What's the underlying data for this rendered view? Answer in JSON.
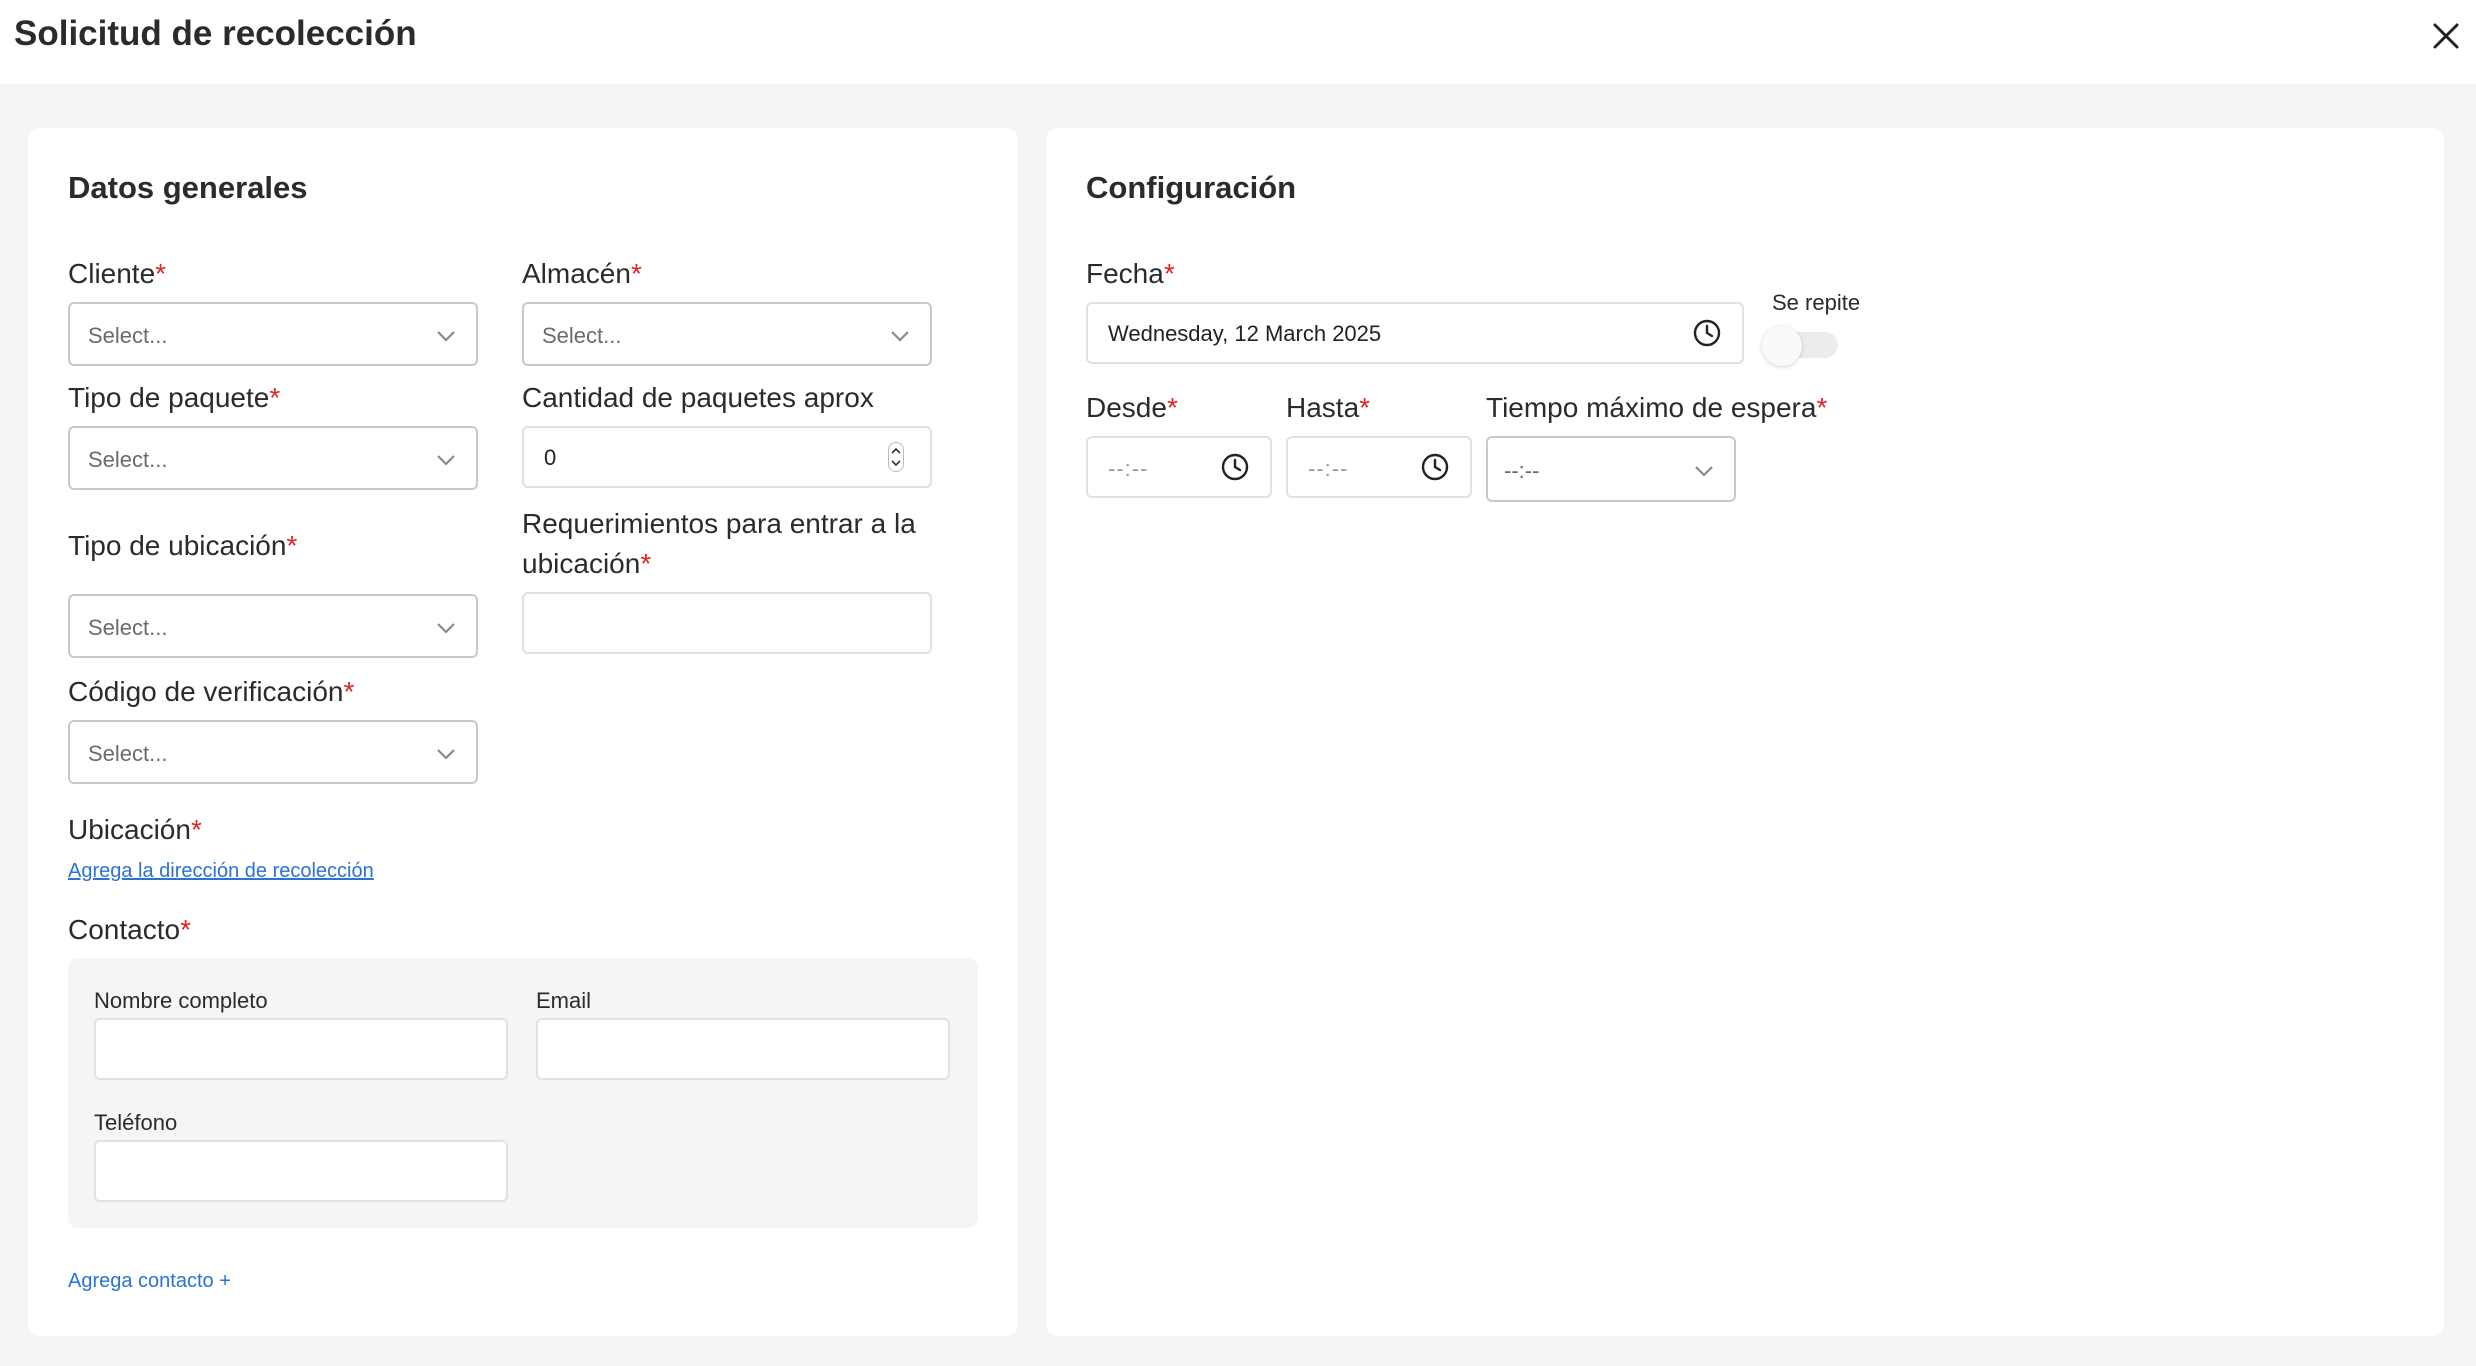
{
  "header": {
    "title": "Solicitud de recolección"
  },
  "general": {
    "section_title": "Datos generales",
    "cliente": {
      "label": "Cliente",
      "placeholder": "Select..."
    },
    "almacen": {
      "label": "Almacén",
      "placeholder": "Select..."
    },
    "tipo_paquete": {
      "label": "Tipo de paquete",
      "placeholder": "Select..."
    },
    "cantidad": {
      "label": "Cantidad de paquetes aprox",
      "value": "0"
    },
    "tipo_ubicacion": {
      "label": "Tipo de ubicación",
      "placeholder": "Select..."
    },
    "requerimientos": {
      "label_line1": "Requerimientos para entrar a la",
      "label_line2": "ubicación",
      "value": ""
    },
    "codigo": {
      "label": "Código de verificación",
      "placeholder": "Select..."
    },
    "ubicacion": {
      "label": "Ubicación",
      "link": "Agrega la dirección de recolección"
    },
    "contacto": {
      "label": "Contacto",
      "nombre_label": "Nombre completo",
      "email_label": "Email",
      "telefono_label": "Teléfono",
      "add_link": "Agrega contacto +"
    },
    "required_mark": "*"
  },
  "config": {
    "section_title": "Configuración",
    "fecha": {
      "label": "Fecha",
      "value": "Wednesday, 12 March 2025"
    },
    "se_repite": {
      "label": "Se repite",
      "enabled": false
    },
    "desde": {
      "label": "Desde",
      "placeholder": "--:--"
    },
    "hasta": {
      "label": "Hasta",
      "placeholder": "--:--"
    },
    "tiempo": {
      "label": "Tiempo máximo de espera",
      "placeholder": "--:--"
    }
  }
}
